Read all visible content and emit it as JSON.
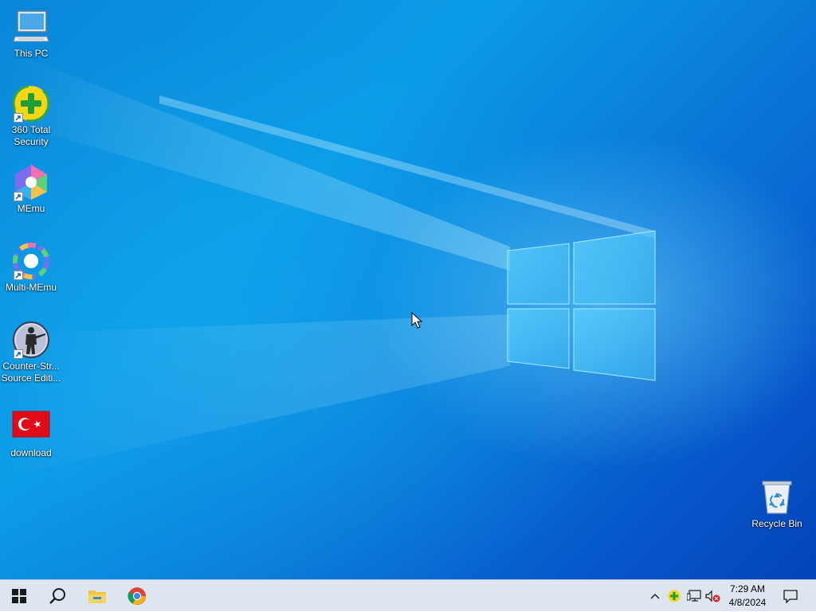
{
  "desktop": {
    "icons": [
      {
        "label": "This PC",
        "icon": "computer-icon"
      },
      {
        "label": "360 Total Security",
        "icon": "360-total-security-icon"
      },
      {
        "label": "MEmu",
        "icon": "memu-icon"
      },
      {
        "label": "Multi-MEmu",
        "icon": "multi-memu-icon"
      },
      {
        "label": "Counter-Str... Source Editi...",
        "icon": "counter-strike-icon"
      },
      {
        "label": "download",
        "icon": "turkey-flag-icon"
      },
      {
        "label": "Recycle Bin",
        "icon": "recycle-bin-icon"
      }
    ]
  },
  "taskbar": {
    "start": "windows-start-icon",
    "search": "search-icon",
    "pinned": [
      "file-explorer-icon",
      "chrome-icon"
    ],
    "tray": [
      "chevron-up-icon",
      "360-tray-icon",
      "network-icon",
      "volume-muted-icon"
    ],
    "clock": {
      "time": "7:29 AM",
      "date": "4/8/2024"
    },
    "notifications": "action-center-icon"
  },
  "colors": {
    "accent": "#0a86d8",
    "taskbar": "#dde6ee"
  }
}
